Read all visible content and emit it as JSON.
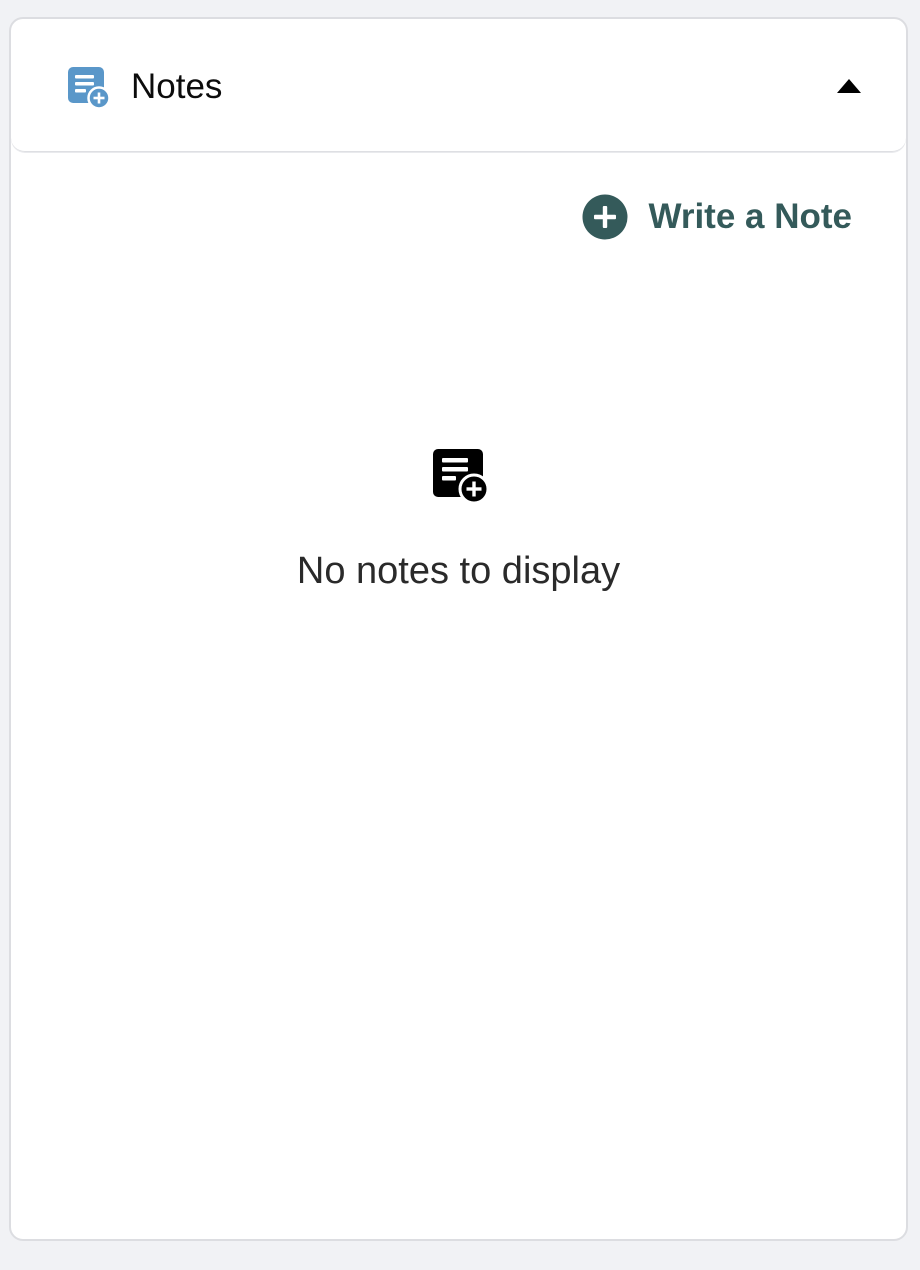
{
  "panel": {
    "title": "Notes",
    "icon": "note-add-icon",
    "toggle_icon": "caret-up-icon",
    "accent_color": "#5a97c9"
  },
  "actions": {
    "write_note_label": "Write a Note",
    "write_note_icon": "plus-circle-icon",
    "write_note_color": "#345a5a"
  },
  "empty_state": {
    "icon": "note-add-icon",
    "message": "No notes to display"
  }
}
